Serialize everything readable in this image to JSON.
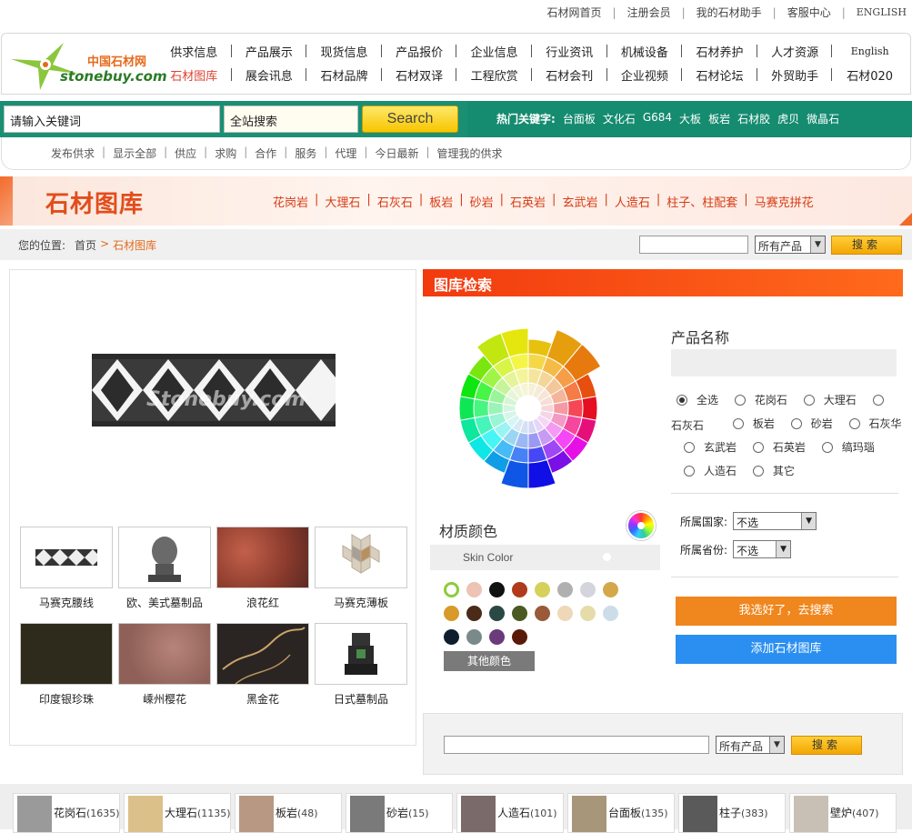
{
  "toplinks": [
    "石材网首页",
    "注册会员",
    "我的石材助手",
    "客服中心",
    "ENGLISH"
  ],
  "logo": {
    "cn": "中国石材网",
    "en": "stonebuy.com"
  },
  "nav": {
    "row1": [
      "供求信息",
      "产品展示",
      "现货信息",
      "产品报价",
      "企业信息",
      "行业资讯",
      "机械设备",
      "石材养护",
      "人才资源",
      "English"
    ],
    "row2": [
      "石材图库",
      "展会讯息",
      "石材品牌",
      "石材双译",
      "工程欣赏",
      "石材会刊",
      "企业视频",
      "石材论坛",
      "外贸助手",
      "石材020"
    ]
  },
  "search": {
    "keyword_value": "请输入关键词",
    "scope_value": "全站搜索",
    "button": "Search"
  },
  "hot_keywords": {
    "label": "热门关键字:",
    "items": [
      "台面板",
      "文化石",
      "G684",
      "大板",
      "板岩",
      "石材胶",
      "虎贝",
      "微晶石"
    ]
  },
  "sublinks": [
    "发布供求",
    "显示全部",
    "供应",
    "求购",
    "合作",
    "服务",
    "代理",
    "今日最新",
    "管理我的供求"
  ],
  "banner": {
    "title": "石材图库",
    "cats": [
      "花岗岩",
      "大理石",
      "石灰石",
      "板岩",
      "砂岩",
      "石英岩",
      "玄武岩",
      "人造石",
      "柱子、柱配套",
      "马赛克拼花"
    ]
  },
  "location": {
    "label": "您的位置:",
    "home": "首页",
    "current": "石材图库",
    "select": "所有产品",
    "button": "搜索"
  },
  "main_image": {
    "watermark": "Stonebuy.com"
  },
  "thumbs": [
    {
      "label": "马赛克腰线",
      "color": "#ffffff"
    },
    {
      "label": "欧、美式墓制品",
      "color": "#f4f4f4"
    },
    {
      "label": "浪花红",
      "color": "#a54a3a"
    },
    {
      "label": "马赛克薄板",
      "color": "#f3eee6"
    },
    {
      "label": "印度银珍珠",
      "color": "#2e2a1c"
    },
    {
      "label": "嵊州樱花",
      "color": "#9c6c62"
    },
    {
      "label": "黑金花",
      "color": "#2a2522"
    },
    {
      "label": "日式墓制品",
      "color": "#f5f5f5"
    }
  ],
  "right_panel": {
    "title": "图库检索",
    "product_name_label": "产品名称",
    "radios": [
      "全选",
      "花岗石",
      "大理石",
      "石灰石",
      "板岩",
      "砂岩",
      "石灰华",
      "玄武岩",
      "石英岩",
      "缟玛瑙",
      "人造石",
      "其它"
    ],
    "selected_radio": "全选",
    "country_label": "所属国家:",
    "country_value": "不选",
    "province_label": "所属省份:",
    "province_value": "不选",
    "search_button": "我选好了，去搜索",
    "add_button": "添加石材图库",
    "material_label": "材质颜色",
    "skin_label": "Skin Color",
    "other_colors": "其他颜色",
    "swatches": [
      "#ffffff",
      "#ecc3b4",
      "#111111",
      "#b03a1a",
      "#d6d15a",
      "#b0b0b0",
      "#d4d4dc",
      "#d4a84a",
      "#d89a28",
      "#4a2a18",
      "#2a4844",
      "#4a5a22",
      "#9a5a3a",
      "#eed8b8",
      "#e6dcaa",
      "#ccdde8",
      "#0e1e2e",
      "#7a8a8a",
      "#6a3a7a",
      "#5a1a0a"
    ]
  },
  "bottom_search": {
    "select": "所有产品",
    "button": "搜索"
  },
  "categories": [
    {
      "name": "花岗石",
      "count": "(1635)",
      "color": "#9a9a9a"
    },
    {
      "name": "大理石",
      "count": "(1135)",
      "color": "#dbc08a"
    },
    {
      "name": "板岩",
      "count": "(48)",
      "color": "#b89882"
    },
    {
      "name": "砂岩",
      "count": "(15)",
      "color": "#7a7a7a"
    },
    {
      "name": "人造石",
      "count": "(101)",
      "color": "#7a6a6a"
    },
    {
      "name": "台面板",
      "count": "(135)",
      "color": "#a8967a"
    },
    {
      "name": "柱子",
      "count": "(383)",
      "color": "#5a5a5a"
    },
    {
      "name": "壁炉",
      "count": "(407)",
      "color": "#c8c0b4"
    }
  ]
}
